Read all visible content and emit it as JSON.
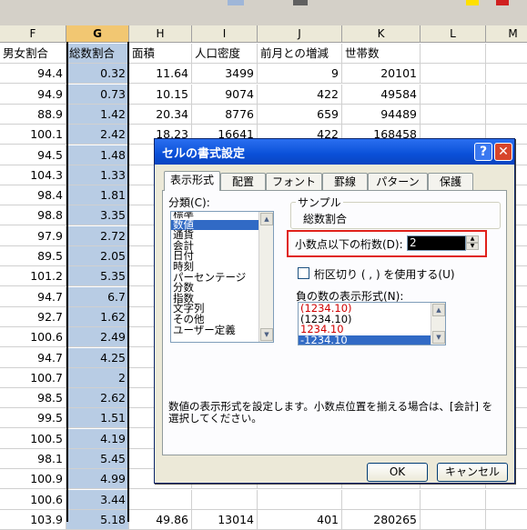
{
  "spreadsheet": {
    "columns": [
      {
        "label": "F",
        "selected": false
      },
      {
        "label": "G",
        "selected": true
      },
      {
        "label": "H",
        "selected": false
      },
      {
        "label": "I",
        "selected": false
      },
      {
        "label": "J",
        "selected": false
      },
      {
        "label": "K",
        "selected": false
      },
      {
        "label": "L",
        "selected": false
      },
      {
        "label": "M",
        "selected": false
      }
    ],
    "header_row": [
      "男女割合",
      "総数割合",
      "面積",
      "人口密度",
      "前月との増減",
      "世帯数"
    ],
    "rows": [
      [
        "94.4",
        "0.32",
        "11.64",
        "3499",
        "9",
        "20101"
      ],
      [
        "94.9",
        "0.73",
        "10.15",
        "9074",
        "422",
        "49584"
      ],
      [
        "88.9",
        "1.42",
        "20.34",
        "8776",
        "659",
        "94489"
      ],
      [
        "100.1",
        "2.42",
        "18.23",
        "16641",
        "422",
        "168458"
      ],
      [
        "94.5",
        "1.48",
        "",
        "",
        "",
        ""
      ],
      [
        "104.3",
        "1.33",
        "",
        "",
        "",
        ""
      ],
      [
        "98.4",
        "1.81",
        "",
        "",
        "",
        ""
      ],
      [
        "98.8",
        "3.35",
        "",
        "",
        "",
        ""
      ],
      [
        "97.9",
        "2.72",
        "",
        "",
        "",
        ""
      ],
      [
        "89.5",
        "2.05",
        "",
        "",
        "",
        ""
      ],
      [
        "101.2",
        "5.35",
        "",
        "",
        "",
        ""
      ],
      [
        "94.7",
        "6.7",
        "",
        "",
        "",
        ""
      ],
      [
        "92.7",
        "1.62",
        "",
        "",
        "",
        ""
      ],
      [
        "100.6",
        "2.49",
        "",
        "",
        "",
        ""
      ],
      [
        "94.7",
        "4.25",
        "",
        "",
        "",
        ""
      ],
      [
        "100.7",
        "2",
        "",
        "",
        "",
        ""
      ],
      [
        "98.5",
        "2.62",
        "",
        "",
        "",
        ""
      ],
      [
        "99.5",
        "1.51",
        "",
        "",
        "",
        ""
      ],
      [
        "100.5",
        "4.19",
        "",
        "",
        "",
        ""
      ],
      [
        "98.1",
        "5.45",
        "",
        "",
        "",
        ""
      ],
      [
        "100.9",
        "4.99",
        "",
        "",
        "",
        ""
      ],
      [
        "100.6",
        "3.44",
        "",
        "",
        "",
        ""
      ],
      [
        "103.9",
        "5.18",
        "49.86",
        "13014",
        "401",
        "280265"
      ]
    ]
  },
  "dialog": {
    "title": "セルの書式設定",
    "help_label": "?",
    "close_label": "✕",
    "tabs": [
      "表示形式",
      "配置",
      "フォント",
      "罫線",
      "パターン",
      "保護"
    ],
    "active_tab": "表示形式",
    "category_label": "分類(C):",
    "categories": [
      "標準",
      "数値",
      "通貨",
      "会計",
      "日付",
      "時刻",
      "パーセンテージ",
      "分数",
      "指数",
      "文字列",
      "その他",
      "ユーザー定義"
    ],
    "selected_category": "数値",
    "sample_label": "サンプル",
    "sample_value": "総数割合",
    "decimal_label": "小数点以下の桁数(D):",
    "decimal_value": "2",
    "separator_label": "桁区切り ( , ) を使用する(U)",
    "separator_checked": false,
    "negative_label": "負の数の表示形式(N):",
    "negative_formats": [
      {
        "text": "(1234.10)",
        "red": true
      },
      {
        "text": "(1234.10)",
        "red": false
      },
      {
        "text": "1234.10",
        "red": true
      },
      {
        "text": "-1234.10",
        "red": false
      }
    ],
    "selected_negative_index": 3,
    "description": "数値の表示形式を設定します。小数点位置を揃える場合は、[会計] を選択してください。",
    "ok_label": "OK",
    "cancel_label": "キャンセル",
    "accent_color": "#e0201a"
  }
}
